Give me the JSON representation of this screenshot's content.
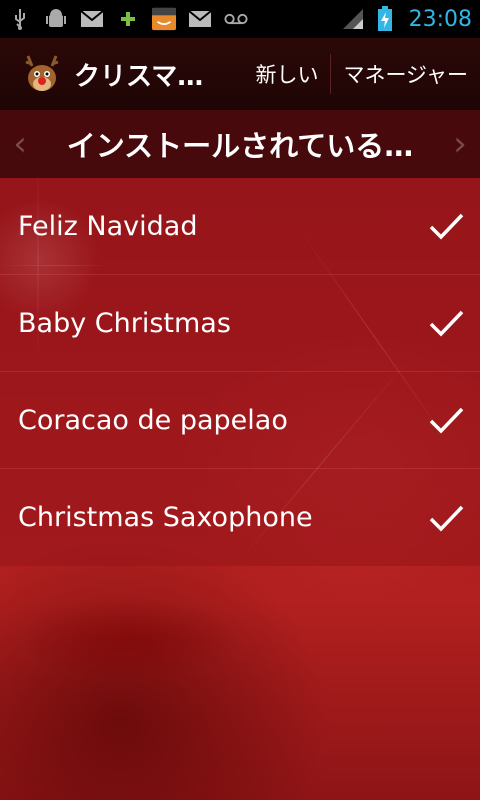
{
  "status_bar": {
    "time": "23:08",
    "icons": [
      "usb-icon",
      "android-debug-icon",
      "gmail-icon",
      "plus-icon",
      "amazon-apps-icon",
      "mail-icon",
      "voicemail-icon",
      "signal-icon",
      "battery-charging-icon"
    ],
    "clock_color": "#33b5e5"
  },
  "action_bar": {
    "title": "クリスマ…",
    "actions": [
      "新しい",
      "マネージャー"
    ]
  },
  "pager": {
    "title": "インストールされている…"
  },
  "list": {
    "items": [
      {
        "label": "Feliz Navidad",
        "checked": true
      },
      {
        "label": "Baby Christmas",
        "checked": true
      },
      {
        "label": "Coracao de papelao",
        "checked": true
      },
      {
        "label": "Christmas Saxophone",
        "checked": true
      }
    ]
  },
  "colors": {
    "accent": "#33b5e5",
    "background": "#a11a1d"
  }
}
